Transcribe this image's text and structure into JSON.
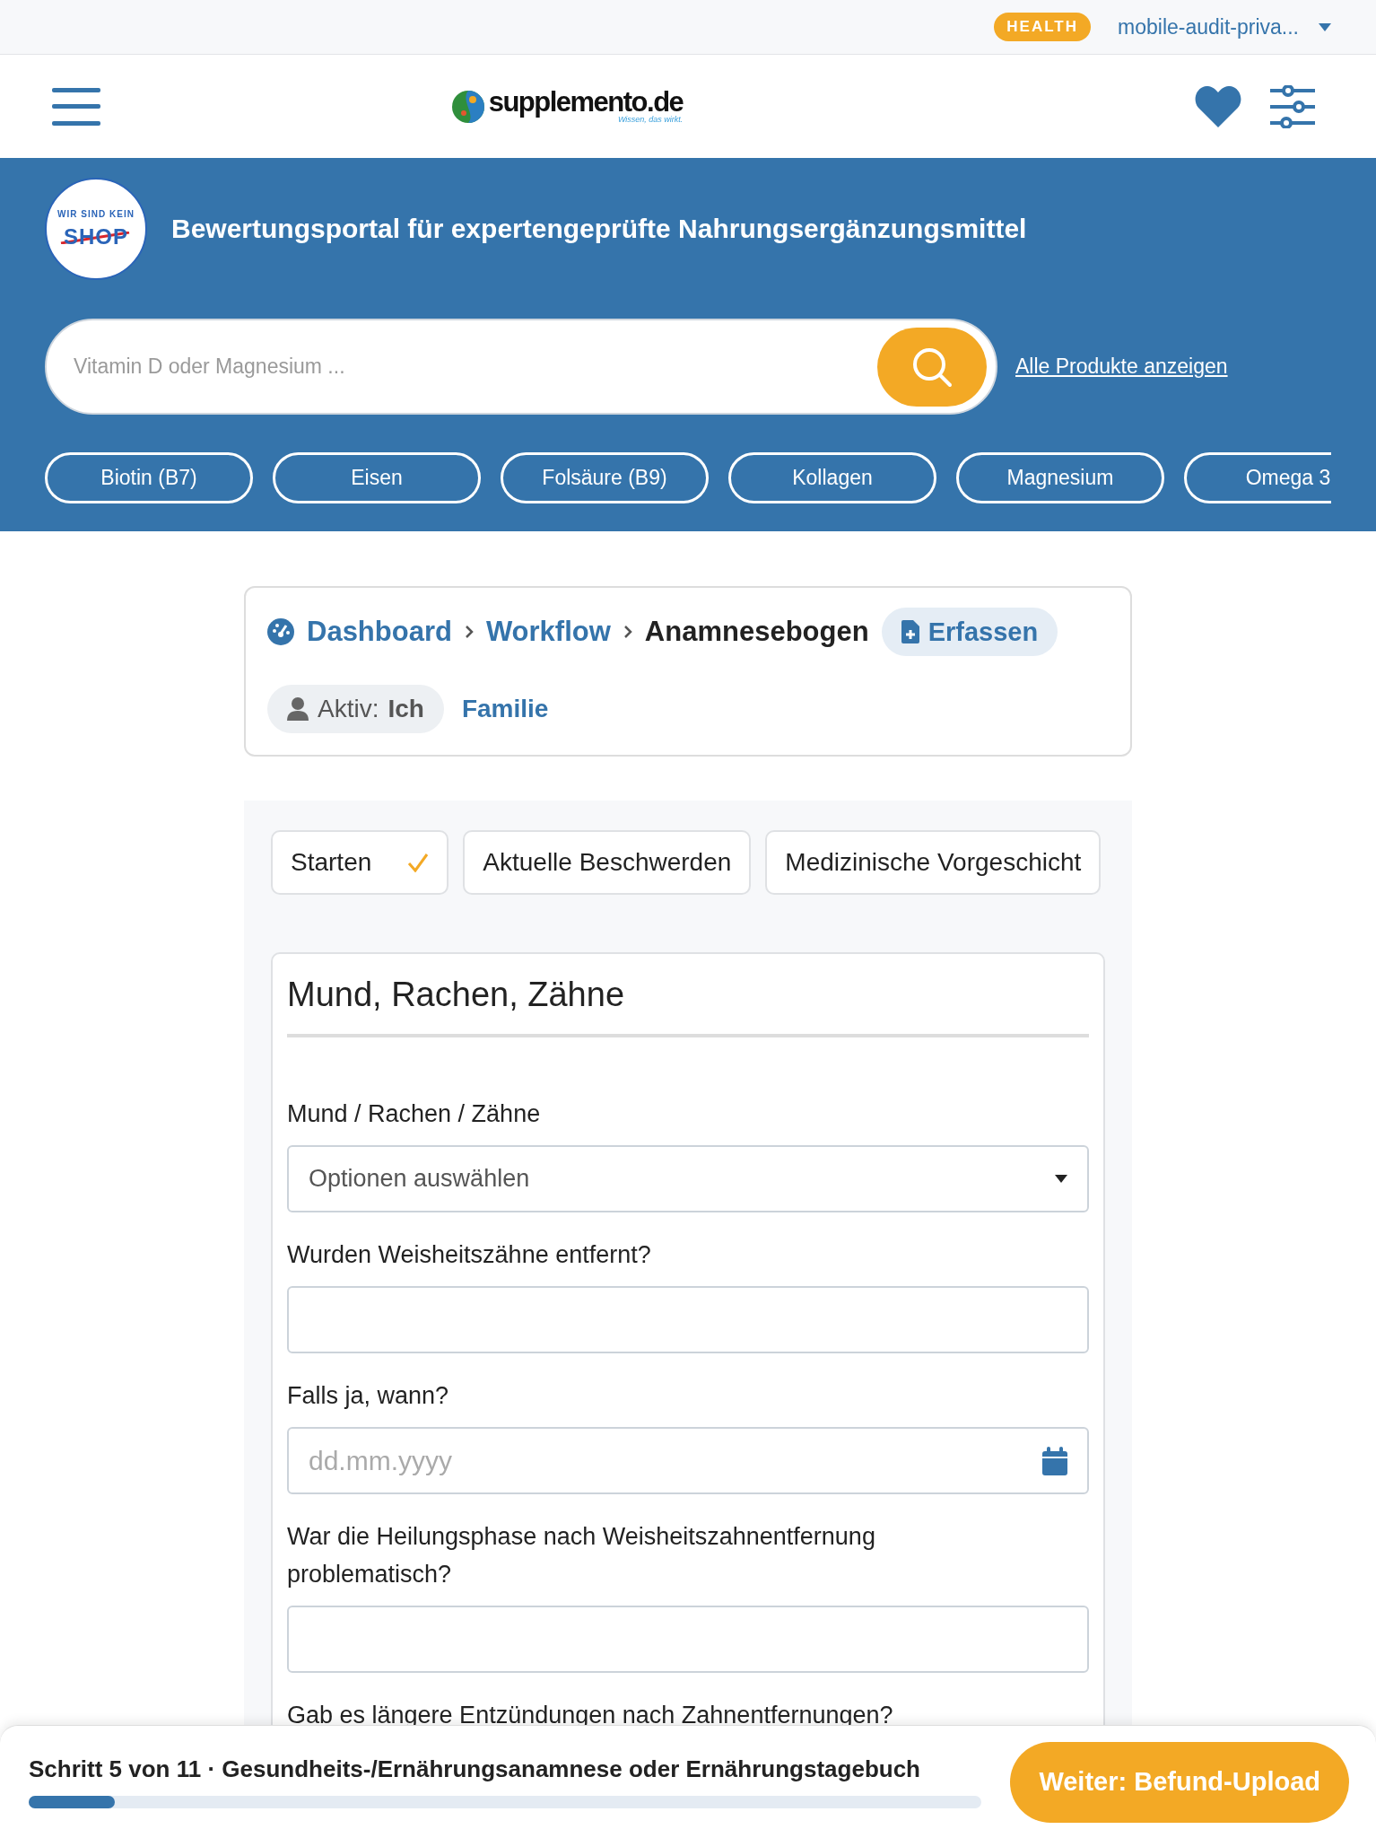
{
  "top_bar": {
    "badge": "HEALTH",
    "account": "mobile-audit-priva..."
  },
  "header": {
    "logo": {
      "name": "supplemento.de",
      "tagline": "Wissen, das wirkt."
    }
  },
  "banner": {
    "shop_badge": {
      "top": "WIR SIND KEIN",
      "main": "SHOP"
    },
    "title": "Bewertungsportal für expertengeprüfte Nahrungsergänzungsmittel",
    "search": {
      "placeholder": "Vitamin D oder Magnesium ..."
    },
    "all_link": "Alle Produkte anzeigen",
    "chips": [
      "Biotin (B7)",
      "Eisen",
      "Folsäure (B9)",
      "Kollagen",
      "Magnesium",
      "Omega 3"
    ]
  },
  "breadcrumb": {
    "items": [
      {
        "label": "Dashboard",
        "kind": "link"
      },
      {
        "label": "Workflow",
        "kind": "link"
      },
      {
        "label": "Anamnesebogen",
        "kind": "current"
      }
    ],
    "action": "Erfassen",
    "profiles": [
      {
        "prefix": "Aktiv:",
        "name": "Ich",
        "selected": true
      },
      {
        "name": "Familie",
        "selected": false
      }
    ]
  },
  "steps": [
    {
      "label": "Starten",
      "done": true
    },
    {
      "label": "Aktuelle Beschwerden",
      "done": false
    },
    {
      "label": "Medizinische Vorgeschicht",
      "done": false
    }
  ],
  "form": {
    "title": "Mund, Rachen, Zähne",
    "fields": [
      {
        "kind": "select",
        "label": "Mund / Rachen / Zähne",
        "placeholder": "Optionen auswählen"
      },
      {
        "kind": "text",
        "label": "Wurden Weisheitszähne entfernt?"
      },
      {
        "kind": "date",
        "label": "Falls ja, wann?",
        "placeholder": "dd.mm.yyyy"
      },
      {
        "kind": "text",
        "label": "War die Heilungsphase nach Weisheitszahnentfernung problematisch?"
      },
      {
        "kind": "label",
        "label": "Gab es längere Entzündungen nach Zahnentfernungen?"
      }
    ]
  },
  "bottom_bar": {
    "step": "Schritt 5 von 11 · Gesundheits-/Ernährungsanamnese oder Ernährungstagebuch",
    "level": 0.09,
    "button": "Weiter: Befund-Upload"
  }
}
